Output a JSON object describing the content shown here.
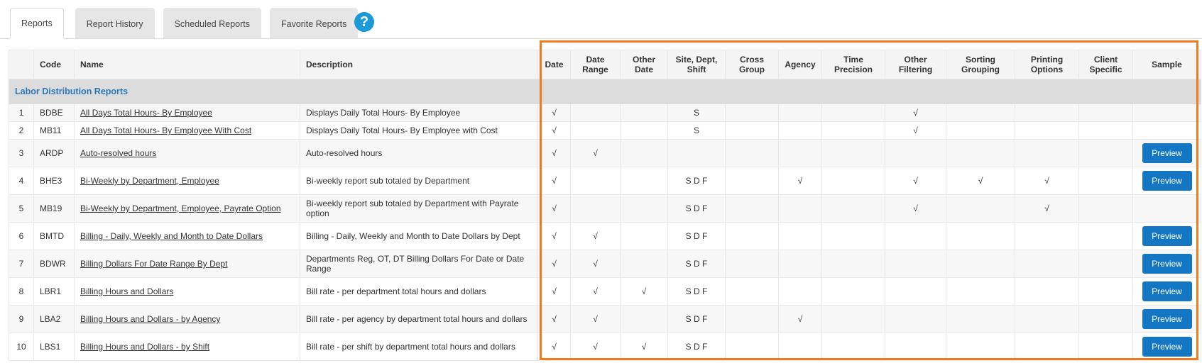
{
  "tabs": [
    "Reports",
    "Report History",
    "Scheduled Reports",
    "Favorite Reports"
  ],
  "help_icon": "?",
  "columns": {
    "code": "Code",
    "name": "Name",
    "description": "Description",
    "date": "Date",
    "date_range": "Date Range",
    "other_date": "Other Date",
    "site_dept_shift": "Site, Dept, Shift",
    "cross_group": "Cross Group",
    "agency": "Agency",
    "time_precision": "Time Precision",
    "other_filtering": "Other Filtering",
    "sorting_grouping": "Sorting Grouping",
    "printing_options": "Printing Options",
    "client_specific": "Client Specific",
    "sample": "Sample"
  },
  "group_title": "Labor Distribution Reports",
  "preview_label": "Preview",
  "check_mark": "√",
  "rows": [
    {
      "num": "1",
      "code": "BDBE",
      "name": "All Days Total Hours- By Employee",
      "description": "Displays Daily Total Hours- By Employee",
      "date": true,
      "date_range": false,
      "other_date": false,
      "sds": "S",
      "cross_group": false,
      "agency": false,
      "time_precision": false,
      "other_filtering": true,
      "sorting_grouping": false,
      "printing_options": false,
      "client_specific": false,
      "preview": false,
      "size": "s"
    },
    {
      "num": "2",
      "code": "MB11",
      "name": "All Days Total Hours- By Employee With Cost",
      "description": "Displays Daily Total Hours- By Employee with Cost",
      "date": true,
      "date_range": false,
      "other_date": false,
      "sds": "S",
      "cross_group": false,
      "agency": false,
      "time_precision": false,
      "other_filtering": true,
      "sorting_grouping": false,
      "printing_options": false,
      "client_specific": false,
      "preview": false,
      "size": "s"
    },
    {
      "num": "3",
      "code": "ARDP",
      "name": "Auto-resolved hours",
      "description": "Auto-resolved hours",
      "date": true,
      "date_range": true,
      "other_date": false,
      "sds": "",
      "cross_group": false,
      "agency": false,
      "time_precision": false,
      "other_filtering": false,
      "sorting_grouping": false,
      "printing_options": false,
      "client_specific": false,
      "preview": true,
      "size": "l"
    },
    {
      "num": "4",
      "code": "BHE3",
      "name": "Bi-Weekly by Department, Employee",
      "description": "Bi-weekly report sub totaled by Department",
      "date": true,
      "date_range": false,
      "other_date": false,
      "sds": "S D F",
      "cross_group": false,
      "agency": true,
      "time_precision": false,
      "other_filtering": true,
      "sorting_grouping": true,
      "printing_options": true,
      "client_specific": false,
      "preview": true,
      "size": "l"
    },
    {
      "num": "5",
      "code": "MB19",
      "name": "Bi-Weekly by Department, Employee, Payrate Option",
      "description": "Bi-weekly report sub totaled by Department with Payrate option",
      "date": true,
      "date_range": false,
      "other_date": false,
      "sds": "S D F",
      "cross_group": false,
      "agency": false,
      "time_precision": false,
      "other_filtering": true,
      "sorting_grouping": false,
      "printing_options": true,
      "client_specific": false,
      "preview": false,
      "size": "l"
    },
    {
      "num": "6",
      "code": "BMTD",
      "name": "Billing - Daily, Weekly and Month to Date Dollars",
      "description": "Billing - Daily, Weekly and Month to Date Dollars by Dept",
      "date": true,
      "date_range": true,
      "other_date": false,
      "sds": "S D F",
      "cross_group": false,
      "agency": false,
      "time_precision": false,
      "other_filtering": false,
      "sorting_grouping": false,
      "printing_options": false,
      "client_specific": false,
      "preview": true,
      "size": "l"
    },
    {
      "num": "7",
      "code": "BDWR",
      "name": "Billing Dollars For Date Range By Dept",
      "description": "Departments Reg, OT, DT Billing Dollars For Date or Date Range",
      "date": true,
      "date_range": true,
      "other_date": false,
      "sds": "S D F",
      "cross_group": false,
      "agency": false,
      "time_precision": false,
      "other_filtering": false,
      "sorting_grouping": false,
      "printing_options": false,
      "client_specific": false,
      "preview": true,
      "size": "l"
    },
    {
      "num": "8",
      "code": "LBR1",
      "name": "Billing Hours and Dollars",
      "description": "Bill rate - per department total hours and dollars",
      "date": true,
      "date_range": true,
      "other_date": true,
      "sds": "S D F",
      "cross_group": false,
      "agency": false,
      "time_precision": false,
      "other_filtering": false,
      "sorting_grouping": false,
      "printing_options": false,
      "client_specific": false,
      "preview": true,
      "size": "l"
    },
    {
      "num": "9",
      "code": "LBA2",
      "name": "Billing Hours and Dollars - by Agency",
      "description": "Bill rate - per agency by department total hours and dollars",
      "date": true,
      "date_range": true,
      "other_date": false,
      "sds": "S D F",
      "cross_group": false,
      "agency": true,
      "time_precision": false,
      "other_filtering": false,
      "sorting_grouping": false,
      "printing_options": false,
      "client_specific": false,
      "preview": true,
      "size": "l"
    },
    {
      "num": "10",
      "code": "LBS1",
      "name": "Billing Hours and Dollars - by Shift",
      "description": "Bill rate - per shift by department total hours and dollars",
      "date": true,
      "date_range": true,
      "other_date": true,
      "sds": "S D F",
      "cross_group": false,
      "agency": false,
      "time_precision": false,
      "other_filtering": false,
      "sorting_grouping": false,
      "printing_options": false,
      "client_specific": false,
      "preview": true,
      "size": "l"
    }
  ],
  "colors": {
    "accent": "#1477c4",
    "highlight_border": "#f07a1e",
    "group_title": "#2a78b8",
    "help_icon_bg": "#1a9ad6"
  }
}
